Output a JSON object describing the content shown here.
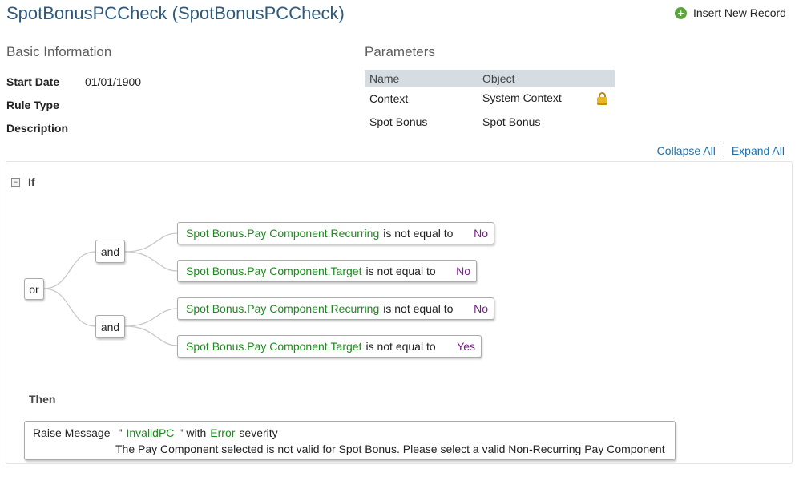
{
  "header": {
    "title": "SpotBonusPCCheck (SpotBonusPCCheck)",
    "insert_label": "Insert New Record"
  },
  "basic_info": {
    "heading": "Basic Information",
    "start_date_label": "Start Date",
    "start_date_value": "01/01/1900",
    "rule_type_label": "Rule Type",
    "description_label": "Description"
  },
  "parameters": {
    "heading": "Parameters",
    "columns": [
      "Name",
      "Object"
    ],
    "rows": [
      {
        "name": "Context",
        "object": "System Context",
        "locked": true
      },
      {
        "name": "Spot Bonus",
        "object": "Spot Bonus",
        "locked": false
      }
    ]
  },
  "links": {
    "collapse_all": "Collapse All",
    "expand_all": "Expand All"
  },
  "rule": {
    "toggle": "−",
    "if_label": "If",
    "root_op": "or",
    "groups": [
      {
        "op": "and",
        "conditions": [
          {
            "field": "Spot Bonus.Pay Component.Recurring",
            "comparator": "is not equal to",
            "value": "No"
          },
          {
            "field": "Spot Bonus.Pay Component.Target",
            "comparator": "is not equal to",
            "value": "No"
          }
        ]
      },
      {
        "op": "and",
        "conditions": [
          {
            "field": "Spot Bonus.Pay Component.Recurring",
            "comparator": "is not equal to",
            "value": "No"
          },
          {
            "field": "Spot Bonus.Pay Component.Target",
            "comparator": "is not equal to",
            "value": "Yes"
          }
        ]
      }
    ],
    "then_label": "Then",
    "action": {
      "verb": "Raise Message",
      "quote_open": "\"",
      "message_key": "InvalidPC",
      "quote_close": "\"",
      "with_text": "with",
      "severity": "Error",
      "severity_suffix": "severity",
      "message_text": "The Pay Component selected is not valid for Spot Bonus. Please select a valid Non-Recurring Pay Component"
    }
  },
  "colors": {
    "title": "#2e5a7d",
    "link": "#1f6fa8",
    "field": "#1c8a1c",
    "value": "#7a1e8a",
    "table_header": "#d6dde2",
    "add_icon": "#5aa63c"
  }
}
